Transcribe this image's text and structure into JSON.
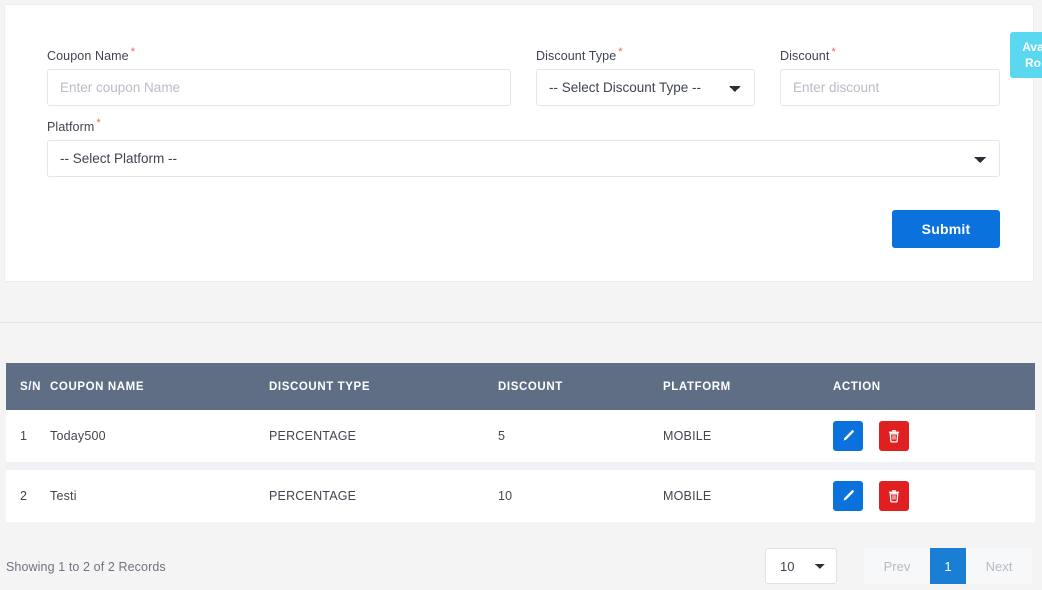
{
  "form": {
    "fields": {
      "coupon_name": {
        "label": "Coupon Name",
        "required_mark": "*",
        "placeholder": "Enter coupon Name",
        "value": ""
      },
      "discount_type": {
        "label": "Discount Type",
        "required_mark": "*",
        "selected": "-- Select Discount Type --"
      },
      "discount": {
        "label": "Discount",
        "required_mark": "*",
        "placeholder": "Enter discount",
        "value": ""
      },
      "platform": {
        "label": "Platform",
        "required_mark": "*",
        "selected": "-- Select Platform --"
      }
    },
    "submit_label": "Submit",
    "submit_color": "#0b72dd"
  },
  "side_tab": {
    "line1": "Ava",
    "line2": "Ro",
    "color": "#5ad8f0"
  },
  "table": {
    "header_color": "#5f6d85",
    "columns": [
      "S/N",
      "COUPON NAME",
      "DISCOUNT TYPE",
      "DISCOUNT",
      "PLATFORM",
      "ACTION"
    ],
    "rows": [
      {
        "sn": "1",
        "coupon_name": "Today500",
        "discount_type": "PERCENTAGE",
        "discount": "5",
        "platform": "MOBILE"
      },
      {
        "sn": "2",
        "coupon_name": "Testi",
        "discount_type": "PERCENTAGE",
        "discount": "10",
        "platform": "MOBILE"
      }
    ],
    "action_icons": {
      "edit": "pencil-icon",
      "delete": "trash-icon"
    },
    "edit_color": "#0b72dd",
    "delete_color": "#e02020"
  },
  "footer": {
    "showing_text": "Showing 1 to 2 of 2 Records",
    "page_size": "10",
    "prev_label": "Prev",
    "page_current": "1",
    "next_label": "Next",
    "active_color": "#1a7fd4"
  }
}
